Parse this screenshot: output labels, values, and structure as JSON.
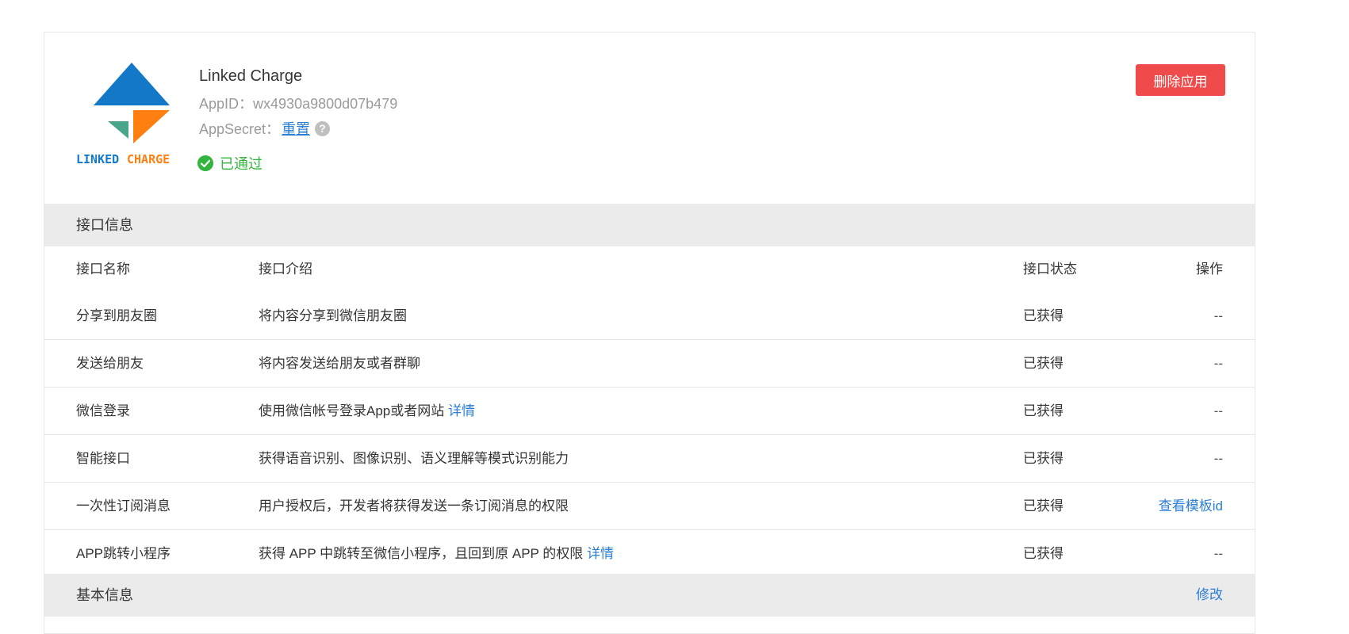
{
  "app": {
    "name": "Linked Charge",
    "logo_text_left": "LINKED",
    "logo_text_right": "CHARGE",
    "appid_label": "AppID：",
    "appid_value": "wx4930a9800d07b479",
    "appsecret_label": "AppSecret：",
    "reset_label": "重置",
    "help_icon": "?",
    "status": "已通过",
    "delete_button": "删除应用"
  },
  "api_section": {
    "title": "接口信息",
    "headers": {
      "name": "接口名称",
      "intro": "接口介绍",
      "status": "接口状态",
      "op": "操作"
    },
    "rows": [
      {
        "name": "分享到朋友圈",
        "intro": "将内容分享到微信朋友圈",
        "intro_link": "",
        "status": "已获得",
        "op": "--"
      },
      {
        "name": "发送给朋友",
        "intro": "将内容发送给朋友或者群聊",
        "intro_link": "",
        "status": "已获得",
        "op": "--"
      },
      {
        "name": "微信登录",
        "intro": "使用微信帐号登录App或者网站 ",
        "intro_link": "详情",
        "status": "已获得",
        "op": "--"
      },
      {
        "name": "智能接口",
        "intro": "获得语音识别、图像识别、语义理解等模式识别能力",
        "intro_link": "",
        "status": "已获得",
        "op": "--"
      },
      {
        "name": "一次性订阅消息",
        "intro": "用户授权后，开发者将获得发送一条订阅消息的权限",
        "intro_link": "",
        "status": "已获得",
        "op_link": "查看模板id"
      },
      {
        "name": "APP跳转小程序",
        "intro": "获得 APP 中跳转至微信小程序，且回到原 APP 的权限 ",
        "intro_link": "详情",
        "status": "已获得",
        "op": "--"
      }
    ]
  },
  "basic_section": {
    "title": "基本信息",
    "edit_label": "修改"
  },
  "colors": {
    "accent_link": "#2b7fd6",
    "danger": "#f04b4b",
    "success": "#33b53d",
    "section_bg": "#ebebeb",
    "logo_blue": "#1478c8",
    "logo_orange": "#ff7f11",
    "logo_teal": "#4aa58a"
  }
}
